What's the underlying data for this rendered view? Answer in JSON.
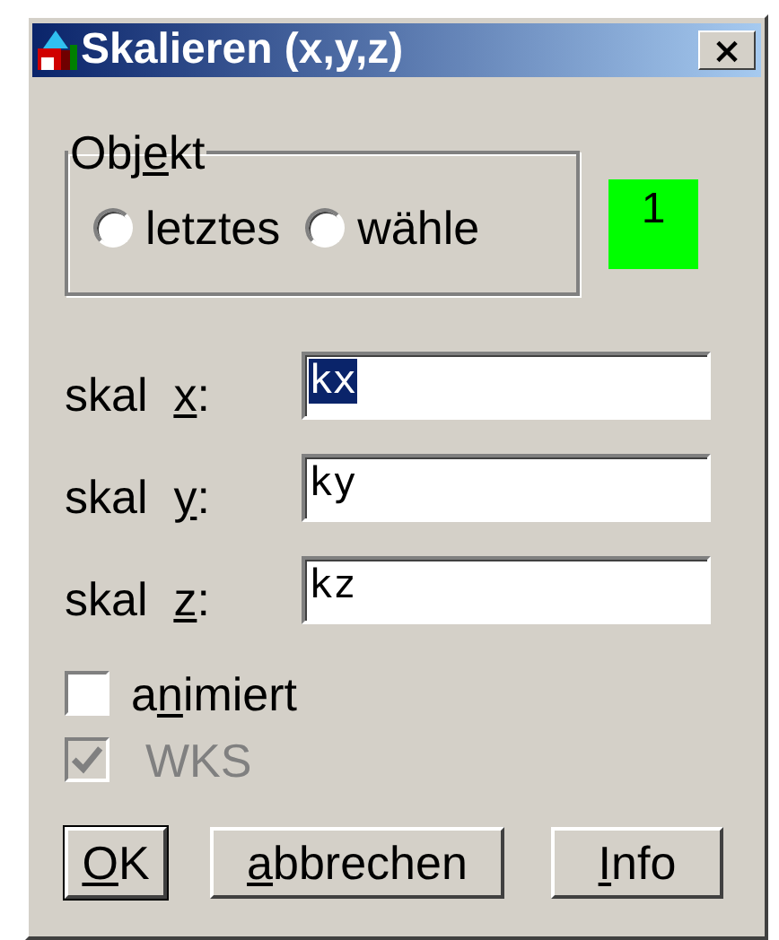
{
  "window": {
    "title": "Skalieren (x,y,z)",
    "close": "×"
  },
  "object_group": {
    "legend_parts": [
      "Obj",
      "e",
      "kt"
    ],
    "options": [
      {
        "label": "letztes",
        "selected": false
      },
      {
        "label": "wähle",
        "selected": false
      }
    ]
  },
  "object_badge": {
    "text": "1",
    "color": "#00ff00"
  },
  "fields": [
    {
      "label_parts": [
        "skal  ",
        "x",
        ":"
      ],
      "value": "kx",
      "selected": true
    },
    {
      "label_parts": [
        "skal  ",
        "y",
        ":"
      ],
      "value": "ky",
      "selected": false
    },
    {
      "label_parts": [
        "skal  ",
        "z",
        ":"
      ],
      "value": "kz",
      "selected": false
    }
  ],
  "checkboxes": [
    {
      "label_parts": [
        "a",
        "n",
        "imiert"
      ],
      "checked": false,
      "disabled": false
    },
    {
      "label_parts": [
        "WKS"
      ],
      "checked": true,
      "disabled": true
    }
  ],
  "buttons": [
    {
      "label_parts": [
        "O",
        "K"
      ],
      "mnemonic_first": true,
      "default": true
    },
    {
      "label_parts": [
        "a",
        "bbrechen"
      ],
      "mnemonic_first": true,
      "default": false
    },
    {
      "label_parts": [
        "I",
        "nfo"
      ],
      "mnemonic_first": true,
      "default": false
    }
  ]
}
